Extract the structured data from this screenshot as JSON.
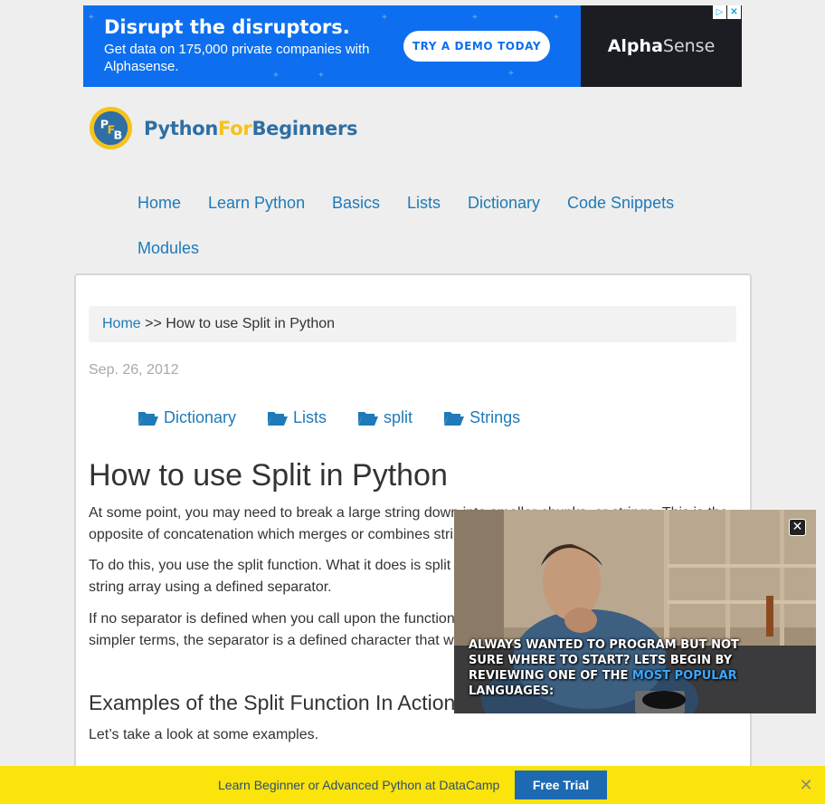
{
  "ad": {
    "headline": "Disrupt the disruptors.",
    "body": "Get data on 175,000 private companies with Alphasense.",
    "cta_label": "TRY A DEMO TODAY",
    "brand_bold": "Alpha",
    "brand_rest": "Sense",
    "brand_color": "#0d6ff0"
  },
  "logo": {
    "text_python": "Python",
    "text_for": "For",
    "text_beginners": "Beginners"
  },
  "nav": {
    "items": [
      "Home",
      "Learn Python",
      "Basics",
      "Lists",
      "Dictionary",
      "Code Snippets",
      "Modules"
    ]
  },
  "breadcrumb": {
    "home": "Home",
    "separator": " >> ",
    "current": "How to use Split in Python"
  },
  "post": {
    "date": "Sep. 26, 2012",
    "tags": [
      "Dictionary",
      "Lists",
      "split",
      "Strings"
    ],
    "title": "How to use Split in Python",
    "paragraphs": [
      "At some point, you may need to break a large string down into smaller chunks, or strings. This is the opposite of concatenation which merges or combines strings into one.",
      "To do this, you use the split function. What it does is split or breakup a string and add the data to a string array using a defined separator.",
      "If no separator is defined when you call upon the function, whitespace will be used by default. In simpler terms, the separator is a defined character that will be placed between each variable."
    ],
    "section_heading": "Examples of the Split Function In Action",
    "section_intro": "Let’s take a look at some examples."
  },
  "video": {
    "caption_main": "Always wanted to program but not sure where to start? Lets begin by reviewing one of the ",
    "caption_highlight": "most popular",
    "caption_end": " languages:",
    "close_label": "✕"
  },
  "bottom_bar": {
    "text": "Learn Beginner or Advanced Python at DataCamp",
    "button_label": "Free Trial",
    "close_label": "✕",
    "bar_color": "#fbe30c"
  },
  "colors": {
    "link": "#1e7ab8",
    "text": "#333333",
    "muted": "#a8a8a8"
  }
}
